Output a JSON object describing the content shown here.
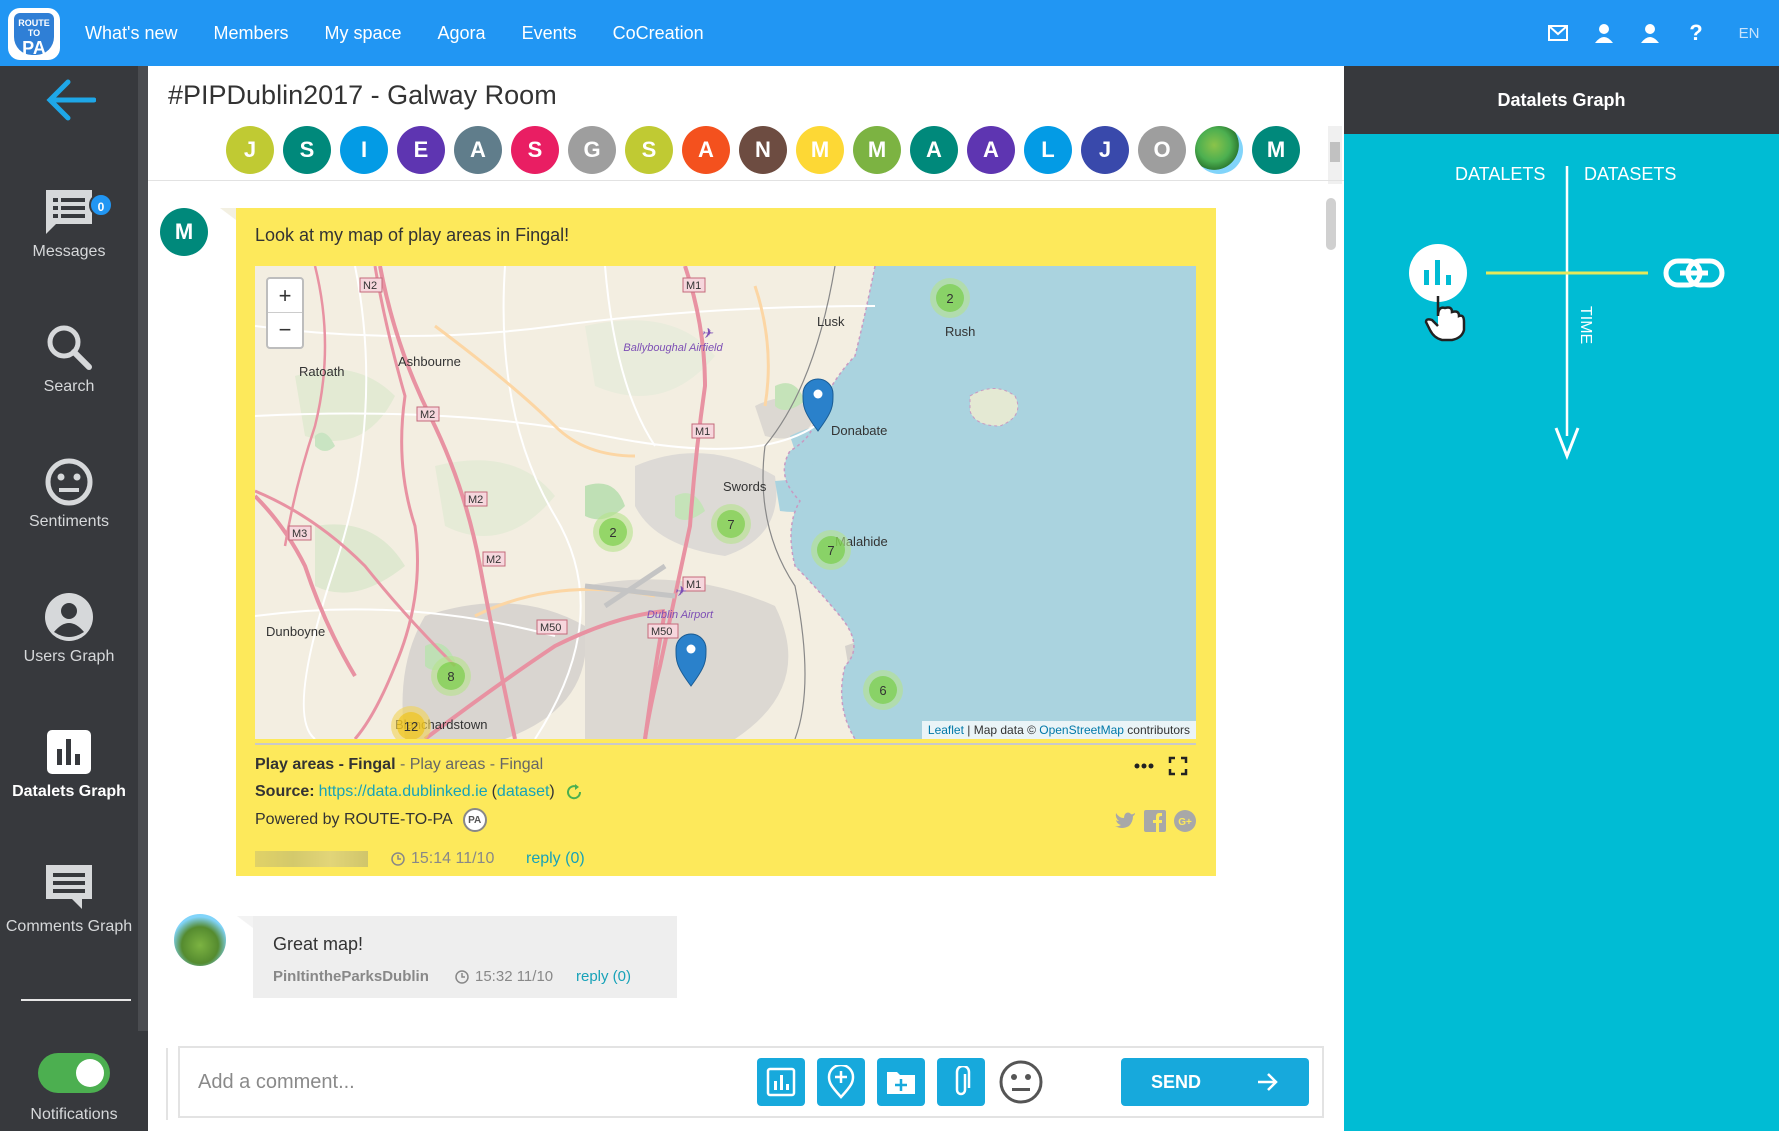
{
  "app": {
    "logo_text_top": "ROUTE TO",
    "logo_text_main": "PA",
    "nav": [
      "What's new",
      "Members",
      "My space",
      "Agora",
      "Events",
      "CoCreation"
    ],
    "lang": "EN"
  },
  "sidebar": {
    "messages_badge": "0",
    "items": [
      {
        "label": "Messages",
        "icon": "messages-icon"
      },
      {
        "label": "Search",
        "icon": "search-icon"
      },
      {
        "label": "Sentiments",
        "icon": "sentiment-icon"
      },
      {
        "label": "Users Graph",
        "icon": "user-icon"
      },
      {
        "label": "Datalets Graph",
        "icon": "chart-icon"
      },
      {
        "label": "Comments Graph",
        "icon": "comment-icon"
      }
    ],
    "notifications_label": "Notifications",
    "notifications_on": true
  },
  "room": {
    "title": "#PIPDublin2017 - Galway Room",
    "members": [
      {
        "initial": "J",
        "color": "#c0ca33"
      },
      {
        "initial": "S",
        "color": "#00897b"
      },
      {
        "initial": "I",
        "color": "#039be5"
      },
      {
        "initial": "E",
        "color": "#5e35b1"
      },
      {
        "initial": "A",
        "color": "#607d8b"
      },
      {
        "initial": "S",
        "color": "#e91e63"
      },
      {
        "initial": "G",
        "color": "#9e9e9e"
      },
      {
        "initial": "S",
        "color": "#c0ca33"
      },
      {
        "initial": "A",
        "color": "#f4511e"
      },
      {
        "initial": "N",
        "color": "#6d4c41"
      },
      {
        "initial": "M",
        "color": "#fdd835"
      },
      {
        "initial": "M",
        "color": "#7cb342"
      },
      {
        "initial": "A",
        "color": "#00897b"
      },
      {
        "initial": "A",
        "color": "#5e35b1"
      },
      {
        "initial": "L",
        "color": "#039be5"
      },
      {
        "initial": "J",
        "color": "#3949ab"
      },
      {
        "initial": "O",
        "color": "#9e9e9e"
      },
      {
        "initial": "",
        "color": "#4caf50"
      },
      {
        "initial": "M",
        "color": "#00897b"
      }
    ]
  },
  "messages": [
    {
      "avatar_initial": "M",
      "avatar_color": "#00897b",
      "text": "Look at my map of play areas in Fingal!",
      "datalet": {
        "title": "Play areas - Fingal",
        "subtitle": " - Play areas - Fingal",
        "source_label": "Source: ",
        "source_url": "https://data.dublinked.ie",
        "dataset_link": "dataset",
        "powered_by": "Powered by ROUTE-TO-PA",
        "powered_logo": "PA"
      },
      "map": {
        "zoom_in": "+",
        "zoom_out": "−",
        "attribution_leaflet": "Leaflet",
        "attribution_sep": " | Map data © ",
        "attribution_osm": "OpenStreetMap",
        "attribution_tail": " contributors",
        "places": [
          "Ratoath",
          "Ashbourne",
          "Lusk",
          "Rush",
          "Ballyboughal Airfield",
          "Donabate",
          "Swords",
          "Malahide",
          "Dublin Airport",
          "Dunboyne",
          "Blanchardstown"
        ],
        "roads": [
          "N2",
          "M1",
          "M2",
          "M3",
          "M50"
        ],
        "clusters": [
          2,
          2,
          7,
          7,
          8,
          12,
          6
        ]
      },
      "author": "",
      "time": "15:14 11/10",
      "reply": "reply (0)"
    },
    {
      "text": "Great map!",
      "author": "PinItintheParksDublin",
      "time": "15:32 11/10",
      "reply": "reply (0)"
    }
  ],
  "composer": {
    "placeholder": "Add a comment...",
    "send": "SEND"
  },
  "panel": {
    "title": "Datalets Graph",
    "left_label": "DATALETS",
    "right_label": "DATASETS",
    "axis_label": "TIME"
  },
  "colors": {
    "topbar": "#2196f3",
    "sidebar": "#37393d",
    "accent": "#17a9dc",
    "panel": "#00bcd4",
    "card": "#fde95b"
  }
}
